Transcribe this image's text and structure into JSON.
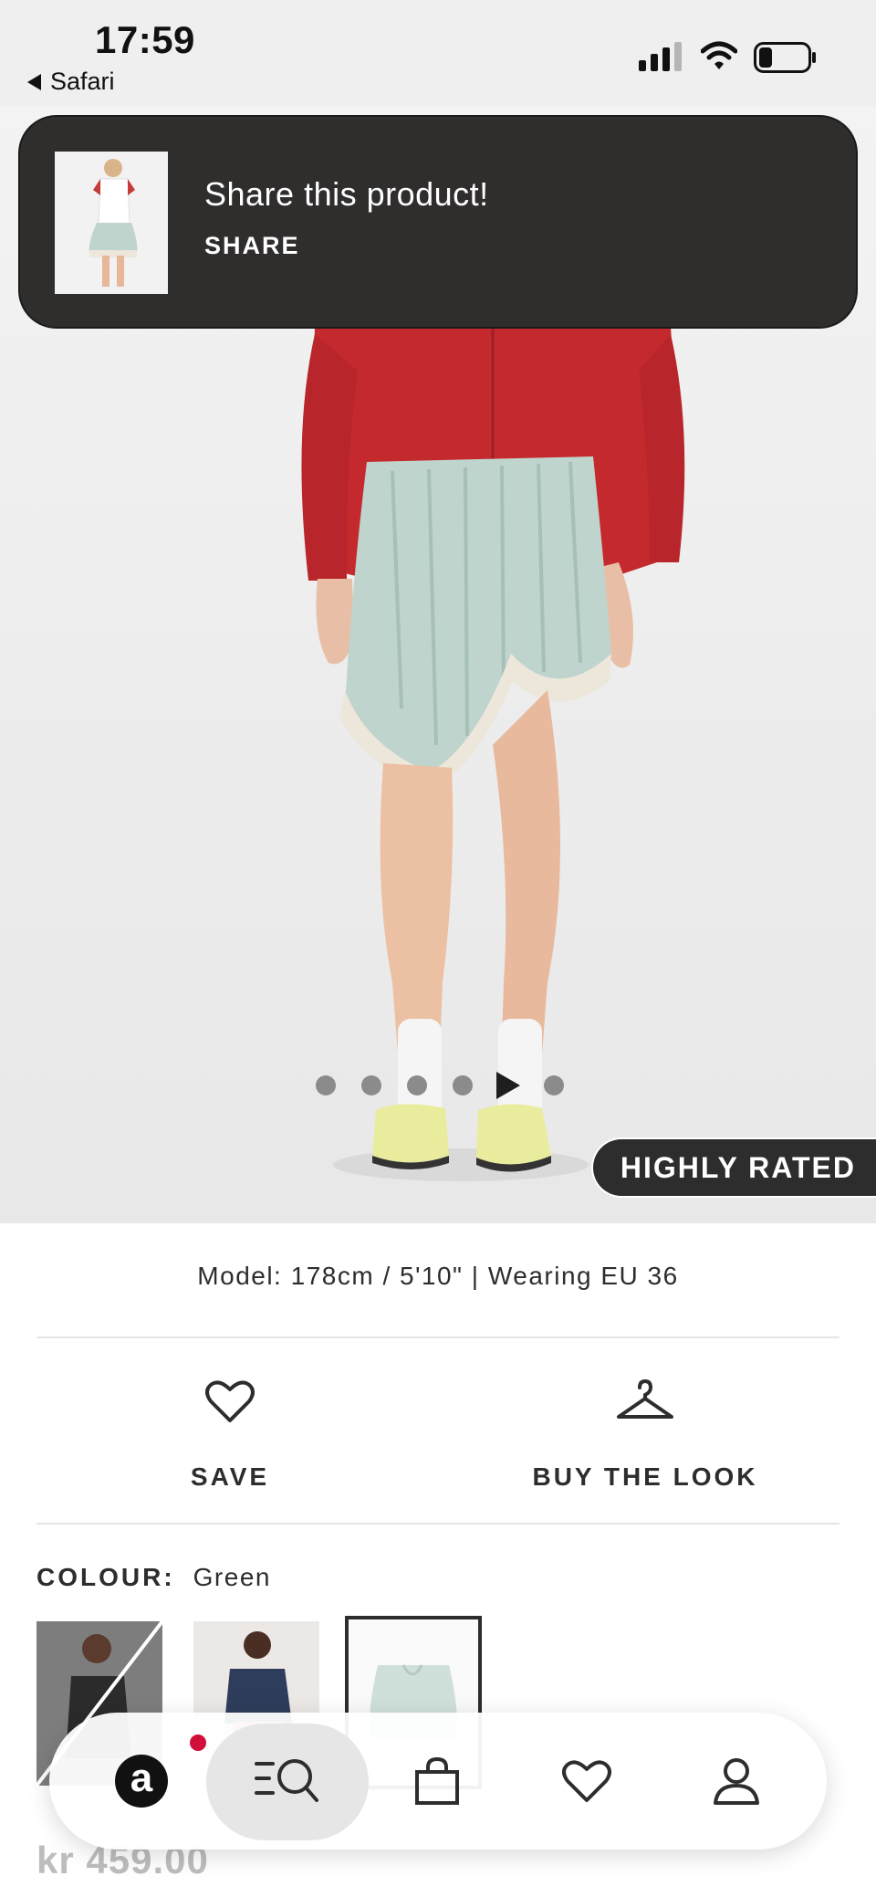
{
  "status_bar": {
    "time": "17:59",
    "back_app": "Safari",
    "icons": [
      "cellular-signal-icon",
      "wifi-icon",
      "battery-icon"
    ]
  },
  "share_toast": {
    "title": "Share this product!",
    "action": "SHARE"
  },
  "gallery": {
    "slide_count": 6,
    "current_slide": 5,
    "current_is_video": true,
    "badge": "HIGHLY RATED"
  },
  "product": {
    "model_info": "Model: 178cm / 5'10\" | Wearing EU 36",
    "save_label": "SAVE",
    "buy_the_look_label": "BUY THE LOOK",
    "colour_label": "COLOUR:",
    "colour_value": "Green",
    "price": "kr 459.00"
  },
  "bottom_nav": {
    "items": [
      "home",
      "search",
      "bag",
      "saved",
      "account"
    ],
    "active": "search",
    "home_logo_letter": "a",
    "has_notification_dot": true
  },
  "colors": {
    "toast_bg": "#302d2d",
    "badge_bg": "#2d2d2d",
    "notification_dot": "#d0103a",
    "text": "#2d2d2d"
  }
}
